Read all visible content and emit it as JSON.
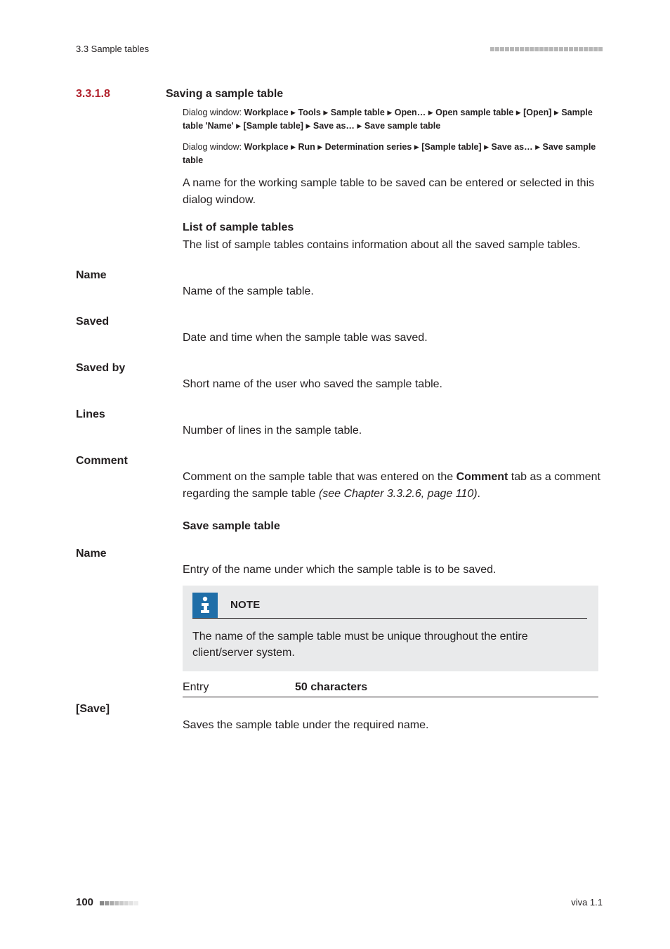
{
  "header": {
    "left": "3.3 Sample tables"
  },
  "section": {
    "number": "3.3.1.8",
    "title": "Saving a sample table"
  },
  "dialog1": {
    "pre": "Dialog window: ",
    "parts": [
      "Workplace",
      "Tools",
      "Sample table",
      "Open…",
      "Open sample table",
      "[Open]",
      "Sample table 'Name'",
      "[Sample table]",
      "Save as…",
      "Save sample table"
    ]
  },
  "dialog2": {
    "pre": "Dialog window: ",
    "parts": [
      "Workplace",
      "Run",
      "Determination series",
      "[Sample table]",
      "Save as…",
      "Save sample table"
    ]
  },
  "intro": "A name for the working sample table to be saved can be entered or selected in this dialog window.",
  "listHead": "List of sample tables",
  "listDesc": "The list of sample tables contains information about all the saved sample tables.",
  "fields": {
    "name": {
      "label": "Name",
      "desc": "Name of the sample table."
    },
    "saved": {
      "label": "Saved",
      "desc": "Date and time when the sample table was saved."
    },
    "savedBy": {
      "label": "Saved by",
      "desc": "Short name of the user who saved the sample table."
    },
    "lines": {
      "label": "Lines",
      "desc": "Number of lines in the sample table."
    },
    "comment": {
      "label": "Comment",
      "desc_a": "Comment on the sample table that was entered on the ",
      "desc_b": "Comment",
      "desc_c": " tab as a comment regarding the sample table ",
      "desc_d": "(see Chapter 3.3.2.6, page 110)",
      "desc_e": "."
    }
  },
  "saveHead": "Save sample table",
  "saveName": {
    "label": "Name",
    "desc": "Entry of the name under which the sample table is to be saved."
  },
  "note": {
    "title": "NOTE",
    "body": "The name of the sample table must be unique throughout the entire client/server system."
  },
  "entry": {
    "label": "Entry",
    "value": "50 characters"
  },
  "saveButton": {
    "label": "[Save]",
    "desc": "Saves the sample table under the required name."
  },
  "footer": {
    "page": "100",
    "right": "viva 1.1"
  }
}
